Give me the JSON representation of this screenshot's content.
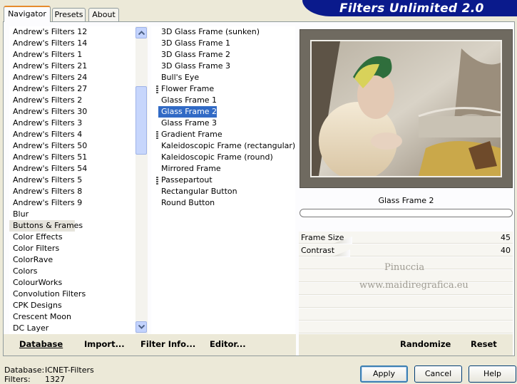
{
  "app": {
    "title": "Filters Unlimited 2.0",
    "colors": {
      "banner": "#0a1a8c",
      "selection": "#316ac5",
      "tab_accent": "#e68b2c"
    }
  },
  "tabs": [
    {
      "label": "Navigator",
      "active": true
    },
    {
      "label": "Presets",
      "active": false
    },
    {
      "label": "About",
      "active": false
    }
  ],
  "categories": {
    "items": [
      "Andrew's Filters 12",
      "Andrew's Filters 14",
      "Andrew's Filters 1",
      "Andrew's Filters 21",
      "Andrew's Filters 24",
      "Andrew's Filters 27",
      "Andrew's Filters 2",
      "Andrew's Filters 30",
      "Andrew's Filters 3",
      "Andrew's Filters 4",
      "Andrew's Filters 50",
      "Andrew's Filters 51",
      "Andrew's Filters 54",
      "Andrew's Filters 5",
      "Andrew's Filters 8",
      "Andrew's Filters 9",
      "Blur",
      "Buttons & Frames",
      "Color Effects",
      "Color Filters",
      "ColorRave",
      "Colors",
      "ColourWorks",
      "Convolution Filters",
      "CPK Designs",
      "Crescent Moon",
      "DC Layer"
    ],
    "selected": "Buttons & Frames",
    "scroll_up_icon": "chevron-up-icon",
    "scroll_down_icon": "chevron-down-icon"
  },
  "filters": {
    "items": [
      {
        "label": "3D Glass Frame (sunken)",
        "grip": false
      },
      {
        "label": "3D Glass Frame 1",
        "grip": false
      },
      {
        "label": "3D Glass Frame 2",
        "grip": false
      },
      {
        "label": "3D Glass Frame 3",
        "grip": false
      },
      {
        "label": "Bull's Eye",
        "grip": false
      },
      {
        "label": "Flower Frame",
        "grip": true
      },
      {
        "label": "Glass Frame 1",
        "grip": false
      },
      {
        "label": "Glass Frame 2",
        "grip": false
      },
      {
        "label": "Glass Frame 3",
        "grip": false
      },
      {
        "label": "Gradient Frame",
        "grip": true
      },
      {
        "label": "Kaleidoscopic Frame (rectangular)",
        "grip": false
      },
      {
        "label": "Kaleidoscopic Frame (round)",
        "grip": false
      },
      {
        "label": "Mirrored Frame",
        "grip": false
      },
      {
        "label": "Passepartout",
        "grip": true
      },
      {
        "label": "Rectangular Button",
        "grip": false
      },
      {
        "label": "Round Button",
        "grip": false
      }
    ],
    "selected": "Glass Frame 2"
  },
  "toolbar": {
    "database": "Database",
    "import": "Import...",
    "filter_info": "Filter Info...",
    "editor": "Editor...",
    "randomize": "Randomize",
    "reset": "Reset"
  },
  "preview": {
    "filter_name": "Glass Frame 2",
    "progress": 0
  },
  "params": [
    {
      "name": "Frame Size",
      "value": "45",
      "fraction": 0.18
    },
    {
      "name": "Contrast",
      "value": "40",
      "fraction": 0.16
    }
  ],
  "watermark": {
    "line1": "Pinuccia",
    "line2": "www.maidiregrafica.eu"
  },
  "footer": {
    "database_label": "Database:",
    "database_value": "ICNET-Filters",
    "filters_label": "Filters:",
    "filters_value": "1327",
    "apply": "Apply",
    "cancel": "Cancel",
    "help": "Help"
  }
}
